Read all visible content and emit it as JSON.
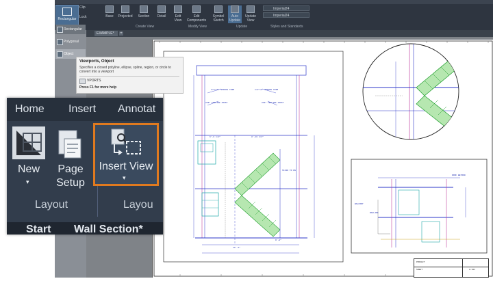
{
  "ribbon": {
    "rectangular_label": "Rectangular",
    "clip_label": "Clip",
    "lock_label": "Lock",
    "buttons": [
      "Base",
      "Projected",
      "Section",
      "Detail",
      "Edit View",
      "Edit Components",
      "Symbol Sketch",
      "Auto Update",
      "Update View"
    ],
    "groups": [
      "Create View",
      "Modify View",
      "Update",
      "Styles and Standards"
    ],
    "dropdown1": "Imperial24",
    "dropdown2": "Imperial24"
  },
  "left_panel": {
    "items": [
      "Rectangular",
      "Polygonal",
      "Object"
    ]
  },
  "doc_tab_small": "EXAMPLE*",
  "tooltip": {
    "title": "Viewports, Object",
    "body": "Specifies a closed polyline, ellipse, spline, region, or circle to convert into a viewport",
    "command": "VPORTS",
    "help": "Press F1 for more help"
  },
  "zoom": {
    "tabs": [
      "Home",
      "Insert",
      "Annotat"
    ],
    "new_label": "New",
    "page_setup_line1": "Page",
    "page_setup_line2": "Setup",
    "insert_view_label": "Insert View",
    "group1": "Layout",
    "group2": "Layou",
    "doc_tabs": [
      "Start",
      "Wall Section*"
    ],
    "accent_color": "#e07a1f"
  },
  "drawing": {
    "section_notes": [
      "1/2\"x6' SPRUCE TRIM",
      "1/2\"x6' SPRUCE TRIM",
      "2X6\" CEILING JOIST",
      "2X4\" CEILING JOIST"
    ],
    "dimensions": [
      "6'-0 1/2\"",
      "8'-10 1/4\"",
      "9'-0\"",
      "13'-4\""
    ],
    "stair_label": "STAIR TO DN",
    "detail_labels": [
      "BALCONY",
      "RAILING",
      "ROOF BEYOND"
    ]
  },
  "title_block": {
    "cells": [
      "PROJECT",
      "SHEET",
      "A-101"
    ]
  }
}
